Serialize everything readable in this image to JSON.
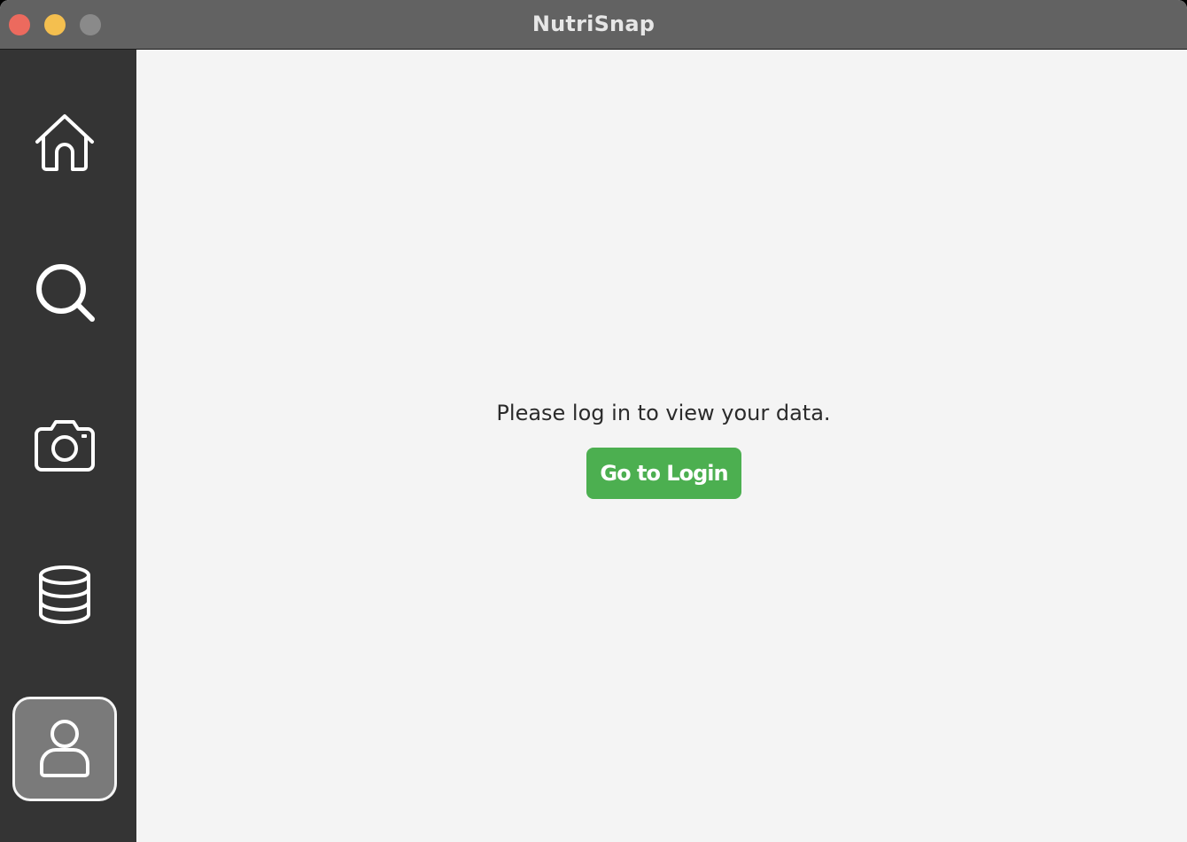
{
  "window": {
    "title": "NutriSnap"
  },
  "sidebar": {
    "items": [
      {
        "icon": "home-icon",
        "active": false
      },
      {
        "icon": "search-icon",
        "active": false
      },
      {
        "icon": "camera-icon",
        "active": false
      },
      {
        "icon": "database-icon",
        "active": false
      },
      {
        "icon": "user-icon",
        "active": true
      }
    ]
  },
  "main": {
    "message": "Please log in to view your data.",
    "login_button_label": "Go to Login"
  },
  "colors": {
    "accent": "#4caf50",
    "sidebar_bg": "#343434",
    "titlebar_bg": "#626262",
    "content_bg": "#f4f4f4"
  }
}
